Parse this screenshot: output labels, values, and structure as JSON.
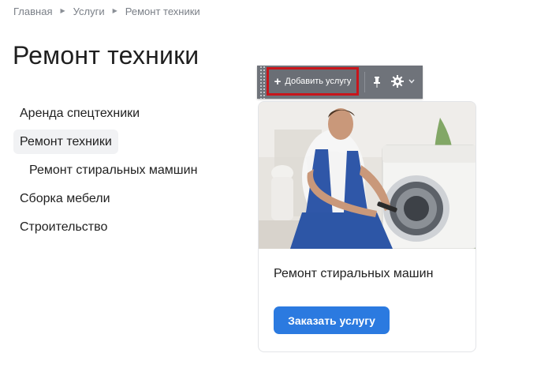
{
  "breadcrumb": {
    "items": [
      "Главная",
      "Услуги",
      "Ремонт техники"
    ]
  },
  "page": {
    "title": "Ремонт техники"
  },
  "sidebar": {
    "items": [
      {
        "label": "Аренда спецтехники",
        "active": false
      },
      {
        "label": "Ремонт техники",
        "active": true
      },
      {
        "label": "Ремонт стиральных мамшин",
        "active": false
      },
      {
        "label": "Сборка мебели",
        "active": false
      },
      {
        "label": "Строительство",
        "active": false
      }
    ]
  },
  "toolbar": {
    "add_label": "Добавить услугу",
    "icons": [
      "plus-icon",
      "pin-icon",
      "gear-icon",
      "caret-down-icon"
    ],
    "highlight_color": "#c8151b"
  },
  "card": {
    "title": "Ремонт стиральных машин",
    "button_label": "Заказать услугу",
    "accent_color": "#2b7ae0"
  }
}
